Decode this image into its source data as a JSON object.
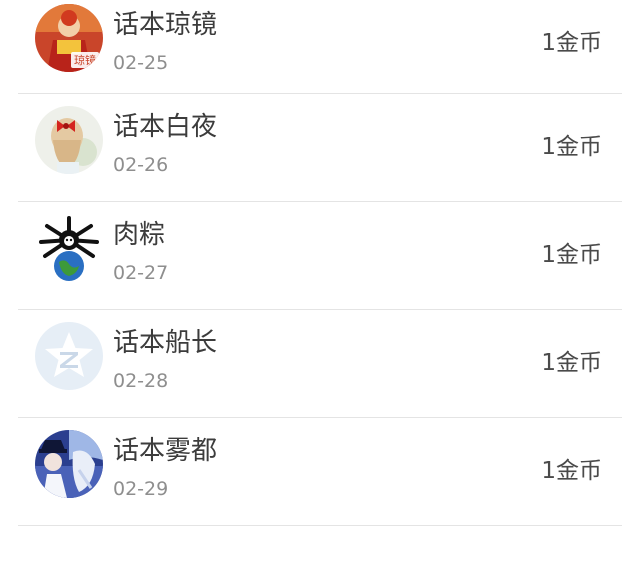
{
  "records": [
    {
      "name": "话本琼镜",
      "date": "02-25",
      "amount": "1金币",
      "avatar_icon": "red-costume-avatar-icon",
      "avatar_text": "琼镜"
    },
    {
      "name": "话本白夜",
      "date": "02-26",
      "amount": "1金币",
      "avatar_icon": "girl-red-bow-avatar-icon"
    },
    {
      "name": "肉粽",
      "date": "02-27",
      "amount": "1金币",
      "avatar_icon": "spider-globe-avatar-icon"
    },
    {
      "name": "话本船长",
      "date": "02-28",
      "amount": "1金币",
      "avatar_icon": "qzone-star-avatar-icon"
    },
    {
      "name": "话本雾都",
      "date": "02-29",
      "amount": "1金币",
      "avatar_icon": "anime-blue-avatar-icon"
    }
  ],
  "colors": {
    "divider": "#e4e4e4",
    "name": "#3c3c3c",
    "date": "#8e8e8e",
    "amount": "#4a4a4a"
  }
}
